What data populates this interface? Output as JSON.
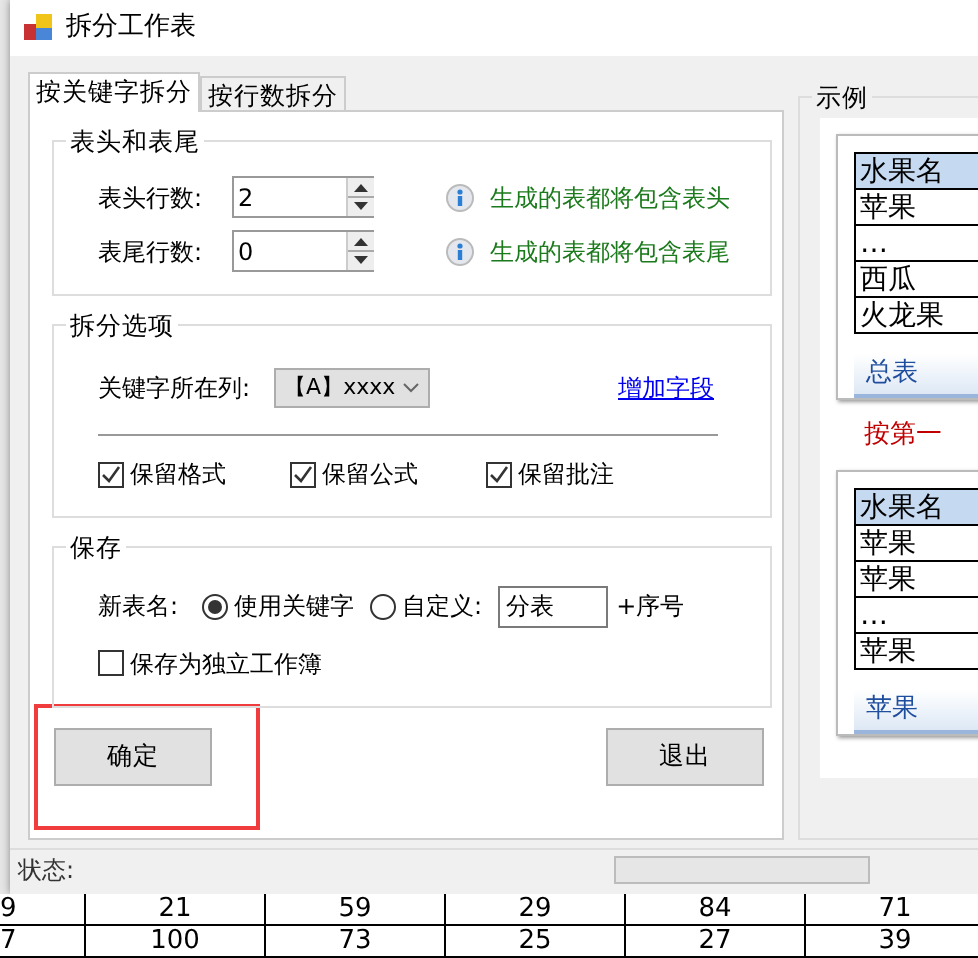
{
  "window": {
    "title": "拆分工作表"
  },
  "tabs": [
    {
      "label": "按关键字拆分",
      "selected": true
    },
    {
      "label": "按行数拆分",
      "selected": false
    }
  ],
  "header_footer": {
    "title": "表头和表尾",
    "rows": [
      {
        "label": "表头行数:",
        "value": "2",
        "hint": "生成的表都将包含表头"
      },
      {
        "label": "表尾行数:",
        "value": "0",
        "hint": "生成的表都将包含表尾"
      }
    ]
  },
  "split_options": {
    "title": "拆分选项",
    "key_column_label": "关键字所在列:",
    "key_column_value": "【A】xxxx",
    "add_field_link": "增加字段",
    "checkboxes": [
      {
        "label": "保留格式",
        "checked": true
      },
      {
        "label": "保留公式",
        "checked": true
      },
      {
        "label": "保留批注",
        "checked": true
      }
    ]
  },
  "save": {
    "title": "保存",
    "name_label": "新表名:",
    "radios": [
      {
        "label": "使用关键字",
        "selected": true
      },
      {
        "label": "自定义:",
        "selected": false
      }
    ],
    "custom_value": "分表",
    "suffix": "+序号",
    "separate_workbook": {
      "label": "保存为独立工作簿",
      "checked": false
    }
  },
  "buttons": [
    {
      "label": "确定",
      "highlighted": true
    },
    {
      "label": "退出",
      "highlighted": false
    }
  ],
  "example": {
    "title": "示例",
    "samples": [
      {
        "rows": [
          "水果名",
          "苹果",
          "…",
          "西瓜",
          "火龙果"
        ],
        "sheet_tab": "总表"
      },
      {
        "rows": [
          "水果名",
          "苹果",
          "苹果",
          "…",
          "苹果"
        ],
        "sheet_tab": "苹果"
      }
    ],
    "caption": "按第一"
  },
  "status_bar": {
    "label": "状态:",
    "progress": {
      "level": 0
    }
  },
  "background_sheet": {
    "rows": [
      [
        "9",
        "21",
        "59",
        "29",
        "84",
        "71"
      ],
      [
        "7",
        "100",
        "73",
        "25",
        "27",
        "39"
      ]
    ]
  }
}
